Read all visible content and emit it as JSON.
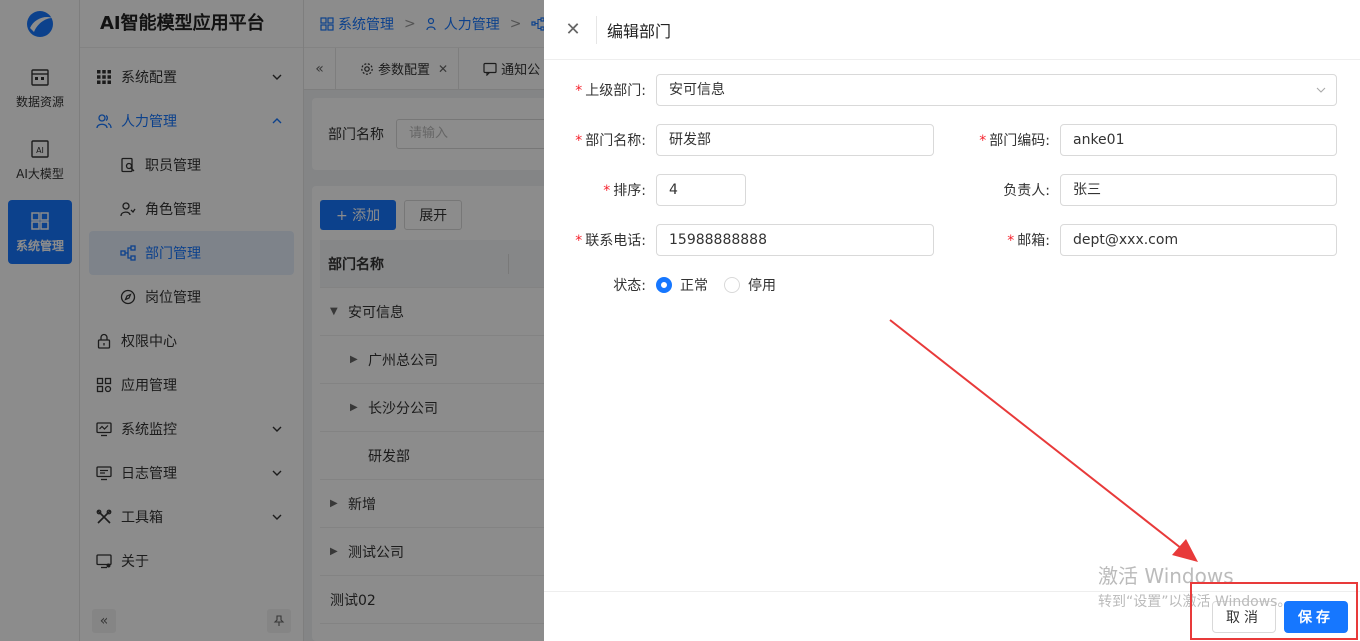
{
  "app": {
    "title": "AI智能模型应用平台"
  },
  "rail": [
    {
      "label": "数据资源"
    },
    {
      "label": "AI大模型"
    },
    {
      "label": "系统管理"
    }
  ],
  "menu": {
    "system_config": "系统配置",
    "hr": "人力管理",
    "staff": "职员管理",
    "roles": "角色管理",
    "departments": "部门管理",
    "positions": "岗位管理",
    "permissions": "权限中心",
    "apps": "应用管理",
    "monitor": "系统监控",
    "logs": "日志管理",
    "toolbox": "工具箱",
    "about": "关于"
  },
  "breadcrumb": [
    "系统管理",
    "人力管理"
  ],
  "tabs": [
    "参数配置",
    "通知公"
  ],
  "search": {
    "label": "部门名称",
    "placeholder": "请输入"
  },
  "toolbar": {
    "add": "+ 添加",
    "expand": "展开"
  },
  "table": {
    "header": "部门名称",
    "rows": [
      {
        "name": "安可信息",
        "level": 0,
        "caret": "▼"
      },
      {
        "name": "广州总公司",
        "level": 1,
        "caret": "▶"
      },
      {
        "name": "长沙分公司",
        "level": 1,
        "caret": "▶"
      },
      {
        "name": "研发部",
        "level": 1,
        "caret": ""
      },
      {
        "name": "新增",
        "level": 0,
        "caret": "▶"
      },
      {
        "name": "测试公司",
        "level": 0,
        "caret": "▶"
      },
      {
        "name": "测试02",
        "level": 0,
        "caret": ""
      }
    ]
  },
  "drawer": {
    "title": "编辑部门",
    "fields": {
      "parent": {
        "label": "上级部门:",
        "value": "安可信息"
      },
      "name": {
        "label": "部门名称:",
        "value": "研发部"
      },
      "code": {
        "label": "部门编码:",
        "value": "anke01"
      },
      "sort": {
        "label": "排序:",
        "value": "4"
      },
      "leader": {
        "label": "负责人:",
        "value": "张三"
      },
      "phone": {
        "label": "联系电话:",
        "value": "15988888888"
      },
      "email": {
        "label": "邮箱:",
        "value": "dept@xxx.com"
      },
      "status": {
        "label": "状态:",
        "options": [
          "正常",
          "停用"
        ],
        "selected": "正常"
      }
    },
    "cancel": "取消",
    "save": "保存"
  },
  "watermark": {
    "line1": "激活 Windows",
    "line2": "转到“设置”以激活 Windows。"
  },
  "colors": {
    "primary": "#1677ff",
    "annotation": "#e83a3a"
  }
}
